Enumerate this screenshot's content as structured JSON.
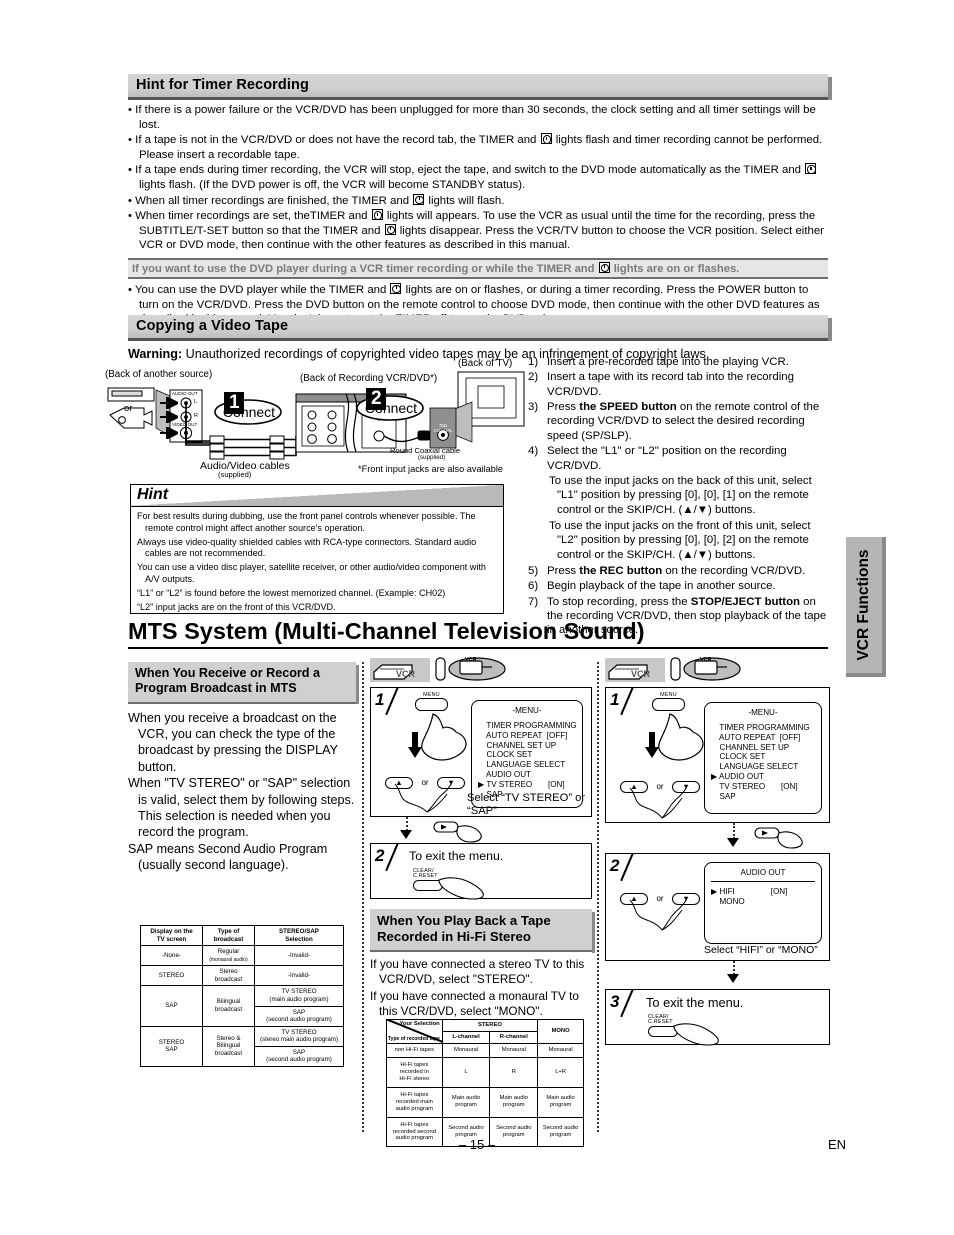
{
  "hint_timer": {
    "heading": "Hint for Timer Recording",
    "bullets": [
      "If there is a power failure or the VCR/DVD has been unplugged for more than 30 seconds, the clock setting and all timer settings will be lost.",
      "If a tape is not in the VCR/DVD or does not have the record tab, the TIMER and |CLK| lights flash and timer recording cannot be performed. Please insert a recordable tape.",
      "If a tape ends during timer recording, the VCR will stop, eject the tape, and switch to the DVD mode automatically as the TIMER and |CLK| lights flash. (If the DVD power is off, the VCR will become STANDBY status).",
      "When all timer recordings are finished, the TIMER and |CLK| lights will flash.",
      "When timer recordings are set, theTIMER and |CLK| lights will appears. To use the VCR as usual until the time for the recording, press the SUBTITLE/T-SET button so that the TIMER and |CLK| lights disappear. Press the VCR/TV button to choose the VCR position. Select either VCR or DVD mode, then continue with the other features as described in this manual."
    ],
    "grey_note": "If you want to use the DVD player during a VCR timer recording or while the TIMER and |CLK| lights are on or flashes.",
    "note_bullet": "You can use the DVD player while the TIMER and |CLK| lights are on or flashes, or during a timer recording. Press the POWER button to turn on the VCR/DVD. Press the DVD button on the remote control to choose DVD mode, then continue with the other DVD features as described in this manual. You don't have to set the TIMER off to use the DVD only."
  },
  "copying": {
    "heading": "Copying a Video Tape",
    "warning_label": "Warning:",
    "warning_text": " Unauthorized recordings of copyrighted video tapes may be an infringement of copyright laws.",
    "diagram": {
      "label_source": "(Back of another source)",
      "label_recorder": "(Back of Recording VCR/DVD*)",
      "label_tv": "(Back of TV)",
      "or": "or",
      "connect1_num": "1",
      "connect1": "Connect",
      "connect2_num": "2",
      "connect2": "Connect",
      "audio_out": "AUDIO OUT",
      "video_out": "VIDEO OUT",
      "jack_l": "L",
      "jack_r": "R",
      "cables": "Audio/Video cables",
      "cables_sub": "(supplied)",
      "coax": "Round Coaxial cable",
      "coax_sub": "(supplied)",
      "footnote": "*Front input jacks are also available",
      "tv_jack": "75Ω\nCOAXIAL"
    },
    "steps": [
      {
        "n": "1)",
        "text": "Insert a pre-recorded tape into the playing VCR."
      },
      {
        "n": "2)",
        "text": "Insert a tape with its record tab into the recording VCR/DVD."
      },
      {
        "n": "3)",
        "pre": "Press ",
        "bold": "the SPEED button",
        "post": " on the remote control of the recording VCR/DVD to select the desired recording speed (SP/SLP)."
      },
      {
        "n": "4)",
        "text": "Select the \"L1\" or \"L2\" position on the recording VCR/DVD."
      }
    ],
    "sub_bullets": [
      "To use the input jacks on the back of this unit, select \"L1\" position by pressing [0], [0], [1] on the remote control or the SKIP/CH. (▲/▼) buttons.",
      "To use the input jacks on the front of this unit, select \"L2\" position by pressing [0], [0], [2] on the remote control or the SKIP/CH. (▲/▼) buttons."
    ],
    "steps2": [
      {
        "n": "5)",
        "pre": "Press ",
        "bold": "the REC button",
        "post": " on the recording VCR/DVD."
      },
      {
        "n": "6)",
        "text": "Begin playback of the tape in another source."
      },
      {
        "n": "7)",
        "pre": "To stop recording, press the ",
        "bold": "STOP/EJECT button",
        "post": " on the recording VCR/DVD, then stop playback of the tape in another source."
      }
    ]
  },
  "hint_box": {
    "title": "Hint",
    "bullets": [
      "For best results during dubbing, use the front panel controls whenever possible. The remote control might affect another source's operation.",
      "Always use video-quality shielded cables with RCA-type connectors. Standard audio cables are not recommended.",
      "You can use a video disc player, satellite receiver, or other audio/video component with A/V outputs.",
      "“L1” or “L2” is found before the lowest memorized channel.  (Example: CH02)",
      "“L2” input jacks are on the front of this VCR/DVD."
    ]
  },
  "mts": {
    "title": "MTS System (Multi-Channel Television Sound)",
    "left": {
      "heading_line1": "When You Receive or Record a",
      "heading_line2": "Program Broadcast in MTS",
      "bullets": [
        "When you receive a broadcast on the VCR, you can check the type of the broadcast by pressing the DISPLAY button.",
        "When \"TV STEREO\" or \"SAP\" selection is valid, select them by following steps. This selection is needed when you record the program.",
        "SAP means Second Audio Program (usually second language)."
      ]
    },
    "table1": {
      "headers": [
        "Display on the\nTV screen",
        "Type of\nbroadcast",
        "STEREO/SAP\nSelection"
      ],
      "rows": [
        {
          "display": "-None-",
          "type": "Regular",
          "type_sub": "(monaural audio)",
          "sel": [
            "-Invalid-"
          ]
        },
        {
          "display": "STEREO",
          "type": "Stereo\nbroadcast",
          "type_sub": "",
          "sel": [
            "-Invalid-"
          ]
        },
        {
          "display": "SAP",
          "type": "Bilingual\nbroadcast",
          "type_sub": "",
          "sel": [
            "TV STEREO\n(main audio program)",
            "SAP\n(second audio program)"
          ]
        },
        {
          "display": "STEREO\nSAP",
          "type": "Stereo &\nBilingual\nbroadcast",
          "type_sub": "",
          "sel": [
            "TV STEREO\n(stereo main audio program)",
            "SAP\n(second audio program)"
          ]
        }
      ]
    },
    "middle": {
      "device_label": "VCR",
      "remote_label": "VCR",
      "step1_num": "1",
      "menu_key": "MENU",
      "up_glyph": "▲",
      "down_glyph": "▼",
      "or": "or",
      "osd_title": "-MENU-",
      "osd_rows": [
        "TIMER PROGRAMMING",
        "AUTO REPEAT  [OFF]",
        "CHANNEL SET UP",
        "CLOCK SET",
        "LANGUAGE SELECT",
        "AUDIO OUT",
        "TV STEREO       [ON]",
        "SAP"
      ],
      "osd_cursor_index": 6,
      "caption_line1": "Select “TV STEREO” or",
      "caption_line2": "“SAP”",
      "step2_num": "2",
      "step2_text": "To exit the menu.",
      "clear_key_line1": "CLEAR/",
      "clear_key_line2": "C.RESET",
      "hifi_heading_line1": "When You Play Back a Tape",
      "hifi_heading_line2": "Recorded in Hi-Fi Stereo",
      "hifi_bullets": [
        "If you have connected a stereo TV to this VCR/DVD, select \"STEREO\".",
        "If you have connected a monaural TV to this VCR/DVD, select \"MONO\"."
      ]
    },
    "table2": {
      "corner_top": "Your Selection",
      "corner_bottom": "Type of recorded tape",
      "h_stereo": "STEREO",
      "h_mono": "MONO",
      "h_l": "L-channel",
      "h_r": "R-channel",
      "rows": [
        {
          "label": "non Hi-Fi tapes",
          "l": "Monaural",
          "r": "Monaural",
          "m": "Monaural"
        },
        {
          "label": "Hi-Fi tapes\nrecorded in\nHi-Fi stereo",
          "l": "L",
          "r": "R",
          "m": "L+R"
        },
        {
          "label": "Hi-Fi tapes\nrecorded main\naudio program",
          "l": "Main audio\nprogram",
          "r": "Main audio\nprogram",
          "m": "Main audio\nprogram"
        },
        {
          "label": "Hi-Fi tapes\nrecorded second\naudio program",
          "l": "Second audio\nprogram",
          "r": "Second audio\nprogram",
          "m": "Second audio\nprogram"
        }
      ]
    },
    "right": {
      "device_label": "VCR",
      "remote_label": "VCR",
      "step1_num": "1",
      "menu_key": "MENU",
      "up_glyph": "▲",
      "down_glyph": "▼",
      "or": "or",
      "osd_title": "-MENU-",
      "osd_rows": [
        "TIMER PROGRAMMING",
        "AUTO REPEAT  [OFF]",
        "CHANNEL SET UP",
        "CLOCK SET",
        "LANGUAGE SELECT",
        "AUDIO OUT",
        "TV STEREO       [ON]",
        "SAP"
      ],
      "osd_cursor_index": 5,
      "step2_num": "2",
      "osd2_title": "AUDIO OUT",
      "osd2_rows": [
        "HIFI                [ON]",
        "MONO"
      ],
      "osd2_cursor_index": 0,
      "caption2": "Select “HIFI” or “MONO”",
      "step3_num": "3",
      "step3_text": "To exit the menu.",
      "clear_key_line1": "CLEAR/",
      "clear_key_line2": "C.RESET"
    }
  },
  "side_tab": {
    "label": "VCR Functions"
  },
  "footer": {
    "page": "– 15 –",
    "lang": "EN"
  }
}
